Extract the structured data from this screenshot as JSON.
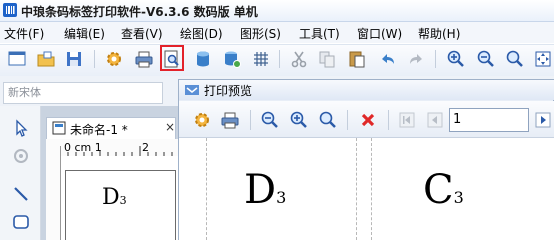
{
  "window": {
    "title": "中琅条码标签打印软件-V6.3.6 数码版 单机"
  },
  "menu": [
    {
      "label": "文件(F)"
    },
    {
      "label": "编辑(E)"
    },
    {
      "label": "查看(V)"
    },
    {
      "label": "绘图(D)"
    },
    {
      "label": "图形(S)"
    },
    {
      "label": "工具(T)"
    },
    {
      "label": "窗口(W)"
    },
    {
      "label": "帮助(H)"
    }
  ],
  "toolbar": {
    "buttons": [
      "new-icon",
      "open-icon",
      "save-icon",
      "settings-icon",
      "print-icon",
      "print-preview-icon",
      "database-icon",
      "database-settings-icon",
      "grid-icon",
      "cut-icon",
      "copy-icon",
      "paste-icon",
      "undo-icon",
      "redo-icon",
      "zoom-in-icon",
      "zoom-out-icon",
      "zoom-fit-icon",
      "fit-page-icon"
    ],
    "highlighted": "print-preview-icon",
    "highlight_color": "#e3222a"
  },
  "font_box": {
    "placeholder": "新宋体"
  },
  "document": {
    "tab_label": "未命名-1 *",
    "close_glyph": "×",
    "ruler_unit": "0 cm 1",
    "ruler_marks": [
      "2"
    ],
    "label_text": "D",
    "label_sub": "3"
  },
  "preview": {
    "title": "打印预览",
    "page_number": "1",
    "labels": [
      {
        "text": "D",
        "sub": "3"
      },
      {
        "text": "C",
        "sub": "3"
      }
    ]
  }
}
